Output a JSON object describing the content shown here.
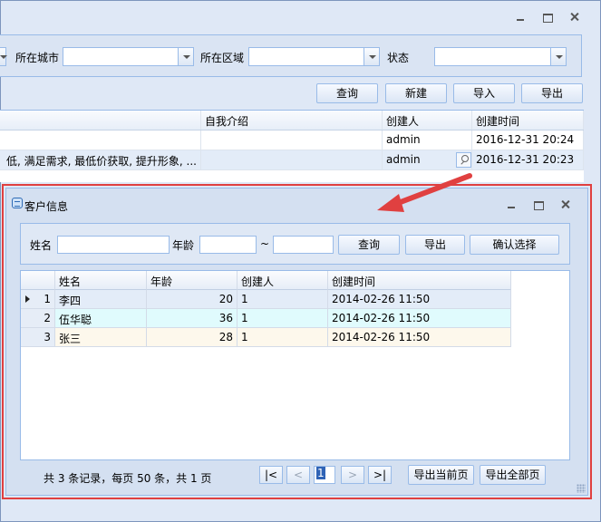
{
  "outer": {
    "filters": {
      "city_label": "所在城市",
      "district_label": "所在区域",
      "status_label": "状态"
    },
    "toolbar": {
      "query": "查询",
      "new": "新建",
      "import": "导入",
      "export": "导出"
    },
    "grid": {
      "headers": [
        "自我介绍",
        "创建人",
        "创建时间"
      ],
      "rows": [
        {
          "desc": "",
          "intro": "",
          "creator": "admin",
          "time": "2016-12-31 20:24"
        },
        {
          "desc": "低, 满足需求, 最低价获取, 提升形象, ...",
          "intro": "",
          "creator": "admin",
          "time": "2016-12-31 20:23"
        }
      ]
    }
  },
  "dialog": {
    "title": "客户信息",
    "filter": {
      "name_label": "姓名",
      "age_label": "年龄",
      "range_sep": "~",
      "query": "查询",
      "export": "导出",
      "confirm": "确认选择"
    },
    "grid": {
      "headers": [
        "",
        "姓名",
        "年龄",
        "创建人",
        "创建时间"
      ],
      "rows": [
        {
          "idx": "1",
          "name": "李四",
          "age": "20",
          "creator": "1",
          "time": "2014-02-26 11:50"
        },
        {
          "idx": "2",
          "name": "伍华聪",
          "age": "36",
          "creator": "1",
          "time": "2014-02-26 11:50"
        },
        {
          "idx": "3",
          "name": "张三",
          "age": "28",
          "creator": "1",
          "time": "2014-02-26 11:50"
        }
      ]
    },
    "pager": {
      "summary": "共 3 条记录，每页 50 条，共 1 页",
      "first": "|<",
      "prev": "<",
      "page": "1",
      "next": ">",
      "last": ">|",
      "export_current": "导出当前页",
      "export_all": "导出全部页"
    }
  },
  "colors": {
    "annotation": "#e04040",
    "row_selected": "#e3ecf8",
    "row_alt1": "#e0fbfd",
    "row_alt2": "#fdf8ec"
  }
}
